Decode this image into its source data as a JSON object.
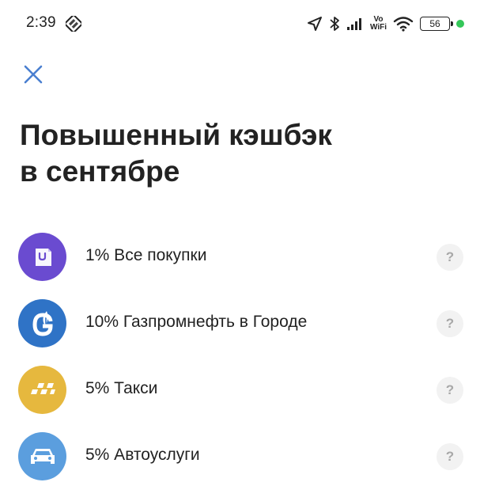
{
  "status_bar": {
    "time": "2:39",
    "vo_label": "Vo",
    "wifi_label": "WiFi",
    "battery_level": "56",
    "status_dot_color": "#34c759"
  },
  "header": {
    "close_icon": "close-icon"
  },
  "page": {
    "title_line1": "Повышенный кэшбэк",
    "title_line2": "в сентябре"
  },
  "cashback_items": [
    {
      "label": "1% Все покупки",
      "icon": "shopping-bag-icon",
      "color": "#6a4bd0",
      "help": "?"
    },
    {
      "label": "10% Газпромнефть в Городе",
      "icon": "gazprom-flame-icon",
      "color": "#2f73c6",
      "help": "?"
    },
    {
      "label": "5% Такси",
      "icon": "taxi-checker-icon",
      "color": "#e6b83e",
      "help": "?"
    },
    {
      "label": "5% Автоуслуги",
      "icon": "car-icon",
      "color": "#5b9ede",
      "help": "?"
    }
  ]
}
